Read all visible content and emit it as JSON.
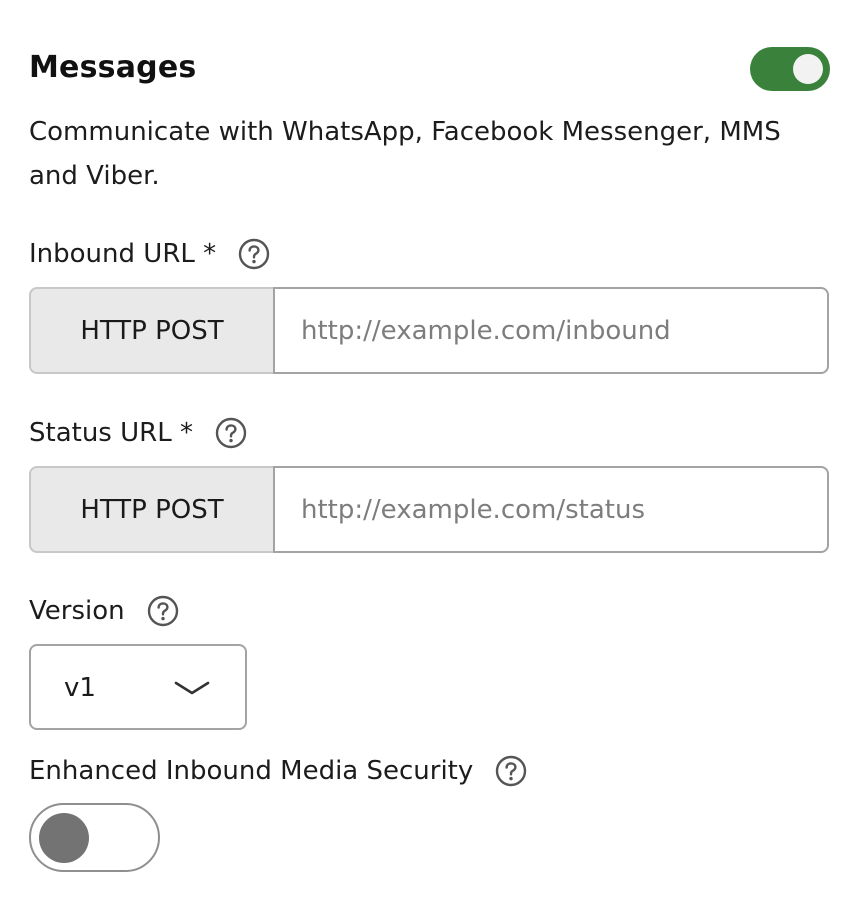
{
  "section": {
    "title": "Messages",
    "enabled": true,
    "description": "Communicate with WhatsApp, Facebook Messenger, MMS and Viber."
  },
  "inbound_url": {
    "label": "Inbound URL *",
    "method": "HTTP POST",
    "value": "",
    "placeholder": "http://example.com/inbound",
    "help_icon": "question-circle-icon"
  },
  "status_url": {
    "label": "Status URL *",
    "method": "HTTP POST",
    "value": "",
    "placeholder": "http://example.com/status",
    "help_icon": "question-circle-icon"
  },
  "version": {
    "label": "Version",
    "selected": "v1",
    "help_icon": "question-circle-icon",
    "dropdown_icon": "chevron-down-icon"
  },
  "media_security": {
    "label": "Enhanced Inbound Media Security",
    "enabled": false,
    "help_icon": "question-circle-icon"
  },
  "colors": {
    "toggle_on": "#3a823c",
    "toggle_off_knob": "#737373",
    "method_background": "#e9e9e9",
    "placeholder_text": "#7d7d7d"
  }
}
